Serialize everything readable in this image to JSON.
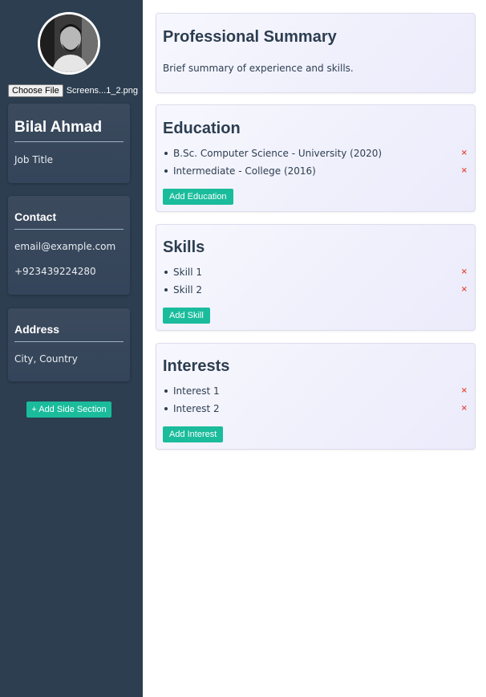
{
  "sidebar": {
    "file_button_label": "Choose File",
    "file_name": "Screens...1_2.png",
    "name": "Bilal Ahmad",
    "job_title": "Job Title",
    "contact": {
      "heading": "Contact",
      "email": "email@example.com",
      "phone": "+923439224280"
    },
    "address": {
      "heading": "Address",
      "value": "City, Country"
    },
    "add_section_label": "+ Add Side Section"
  },
  "main": {
    "summary": {
      "heading": "Professional Summary",
      "text": "Brief summary of experience and skills."
    },
    "education": {
      "heading": "Education",
      "items": [
        "B.Sc. Computer Science - University (2020)",
        "Intermediate - College (2016)"
      ],
      "add_label": "Add Education"
    },
    "skills": {
      "heading": "Skills",
      "items": [
        "Skill 1",
        "Skill 2"
      ],
      "add_label": "Add Skill"
    },
    "interests": {
      "heading": "Interests",
      "items": [
        "Interest 1",
        "Interest 2"
      ],
      "add_label": "Add Interest"
    },
    "remove_glyph": "×"
  },
  "colors": {
    "sidebar_bg": "#2c3e50",
    "accent": "#1abc9c",
    "remove": "#e74c3c"
  }
}
